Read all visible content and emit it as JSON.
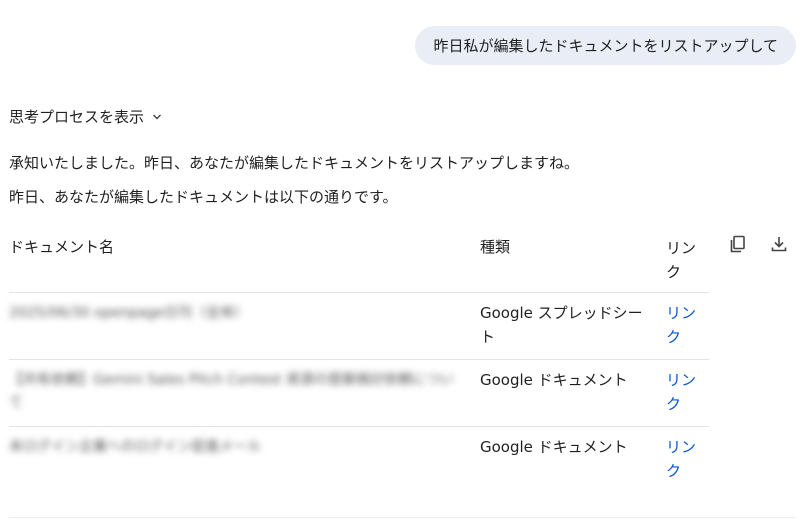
{
  "user_message": "昨日私が編集したドキュメントをリストアップして",
  "thinking_toggle_label": "思考プロセスを表示",
  "response": {
    "intro": "承知いたしました。昨日、あなたが編集したドキュメントをリストアップしますね。",
    "summary": "昨日、あなたが編集したドキュメントは以下の通りです。"
  },
  "table": {
    "headers": {
      "name": "ドキュメント名",
      "type": "種類",
      "link": "リンク"
    },
    "rows": [
      {
        "name": "2025/06/30 openpage日刊（全体）",
        "type": "Google スプレッドシート",
        "link": "リンク"
      },
      {
        "name": "【共有依頼】Gemini Sales Pitch Contest 資源の提案検討依頼について",
        "type": "Google ドキュメント",
        "link": "リンク"
      },
      {
        "name": "本ログイン企業へのログイン促進メール",
        "type": "Google ドキュメント",
        "link": "リンク"
      }
    ],
    "tools": {
      "copy_icon": "copy-icon",
      "download_icon": "download-icon"
    }
  },
  "colors": {
    "bubble_bg": "#e9eef6",
    "link": "#0b57d0",
    "divider": "#e3e3e3"
  }
}
